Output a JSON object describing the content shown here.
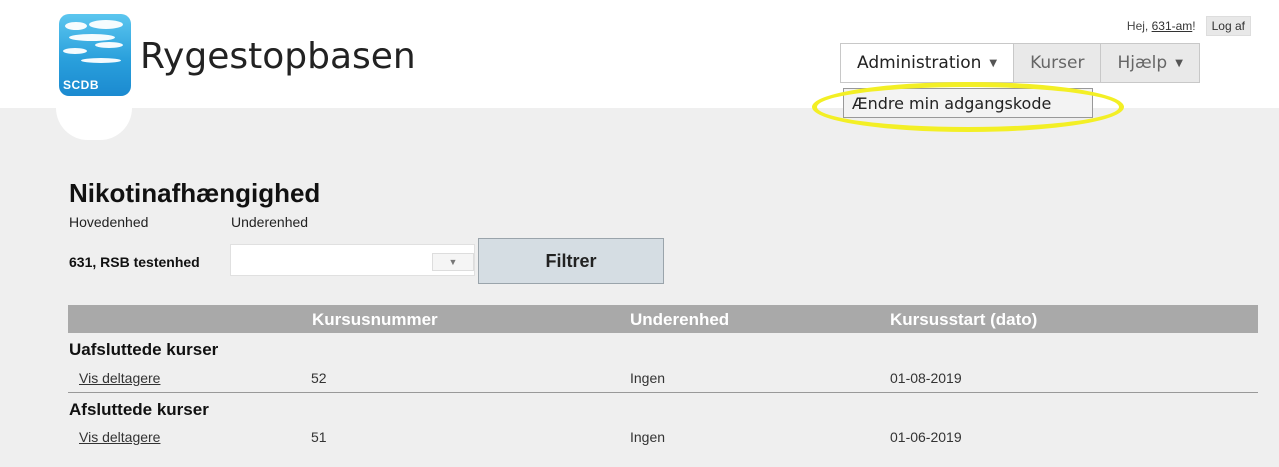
{
  "header": {
    "site_title": "Rygestopbasen",
    "logo_text": "SCDB",
    "greeting": "Hej,",
    "username": "631-am",
    "greeting_suffix": "!",
    "logout_label": "Log af"
  },
  "nav": {
    "items": [
      {
        "label": "Administration",
        "has_caret": true,
        "active": true
      },
      {
        "label": "Kurser",
        "has_caret": false,
        "active": false
      },
      {
        "label": "Hjælp",
        "has_caret": true,
        "active": false
      }
    ],
    "dropdown_item": "Ændre min adgangskode",
    "highlight_color": "#f3ef25"
  },
  "page": {
    "title": "Nikotinafhængighed",
    "label_main_unit": "Hovedenhed",
    "label_sub_unit": "Underenhed",
    "main_unit_value": "631, RSB testenhed",
    "sub_unit_value": "",
    "filter_label": "Filtrer"
  },
  "table": {
    "headers": [
      "Kursusnummer",
      "Underenhed",
      "Kursusstart (dato)"
    ],
    "header_bg": "#a9a9a9",
    "groups": [
      {
        "title": "Uafsluttede kurser",
        "rows": [
          {
            "action": "Vis deltagere",
            "course_number": "52",
            "sub_unit": "Ingen",
            "start_date": "01-08-2019"
          }
        ]
      },
      {
        "title": "Afsluttede kurser",
        "rows": [
          {
            "action": "Vis deltagere",
            "course_number": "51",
            "sub_unit": "Ingen",
            "start_date": "01-06-2019"
          }
        ]
      }
    ]
  }
}
